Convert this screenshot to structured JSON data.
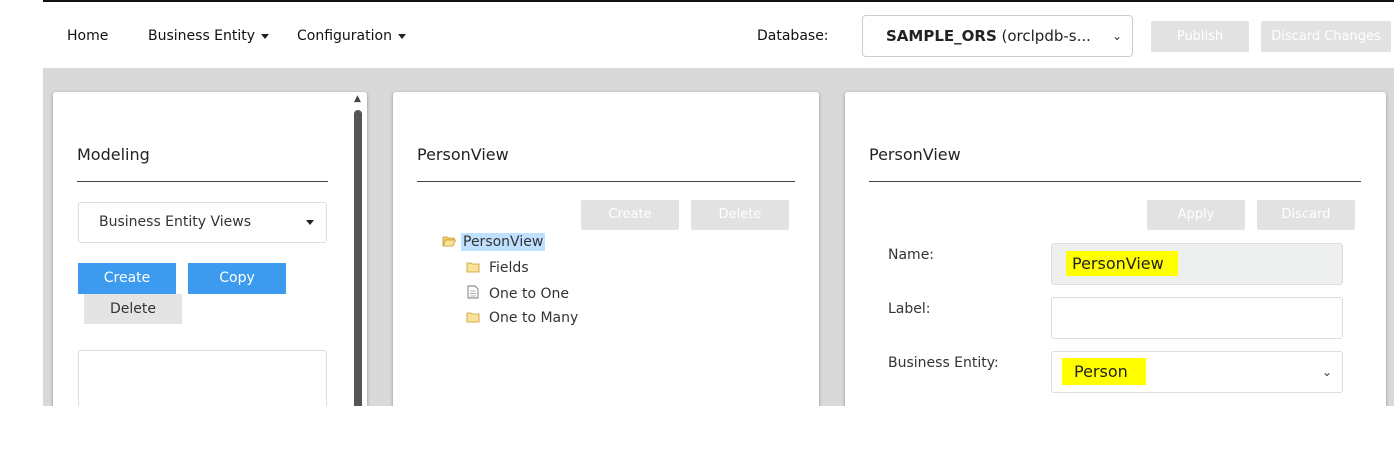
{
  "nav": {
    "home": "Home",
    "business_entity": "Business Entity",
    "configuration": "Configuration",
    "database_label": "Database:",
    "database_value_bold": "SAMPLE_ORS",
    "database_value_rest": " (orclpdb-s...",
    "publish": "Publish",
    "discard_changes": "Discard Changes"
  },
  "modeling": {
    "title": "Modeling",
    "view_select": "Business Entity Views",
    "create": "Create",
    "copy": "Copy",
    "delete": "Delete"
  },
  "tree_panel": {
    "title": "PersonView",
    "create": "Create",
    "delete": "Delete",
    "root": "PersonView",
    "children": [
      "Fields",
      "One to One",
      "One to Many"
    ]
  },
  "detail_panel": {
    "title": "PersonView",
    "apply": "Apply",
    "discard": "Discard",
    "name_label": "Name:",
    "name_value": "PersonView",
    "label_label": "Label:",
    "label_value": "",
    "business_entity_label": "Business Entity:",
    "business_entity_value": "Person"
  },
  "colors": {
    "accent_blue": "#3d9bef",
    "highlight_yellow": "#ffff00",
    "selection_blue": "#bfe0ff",
    "workspace_gray": "#d9d9d9"
  },
  "icons": [
    "folder-open-icon",
    "folder-icon",
    "document-icon",
    "chevron-down-icon",
    "caret-down-icon"
  ]
}
